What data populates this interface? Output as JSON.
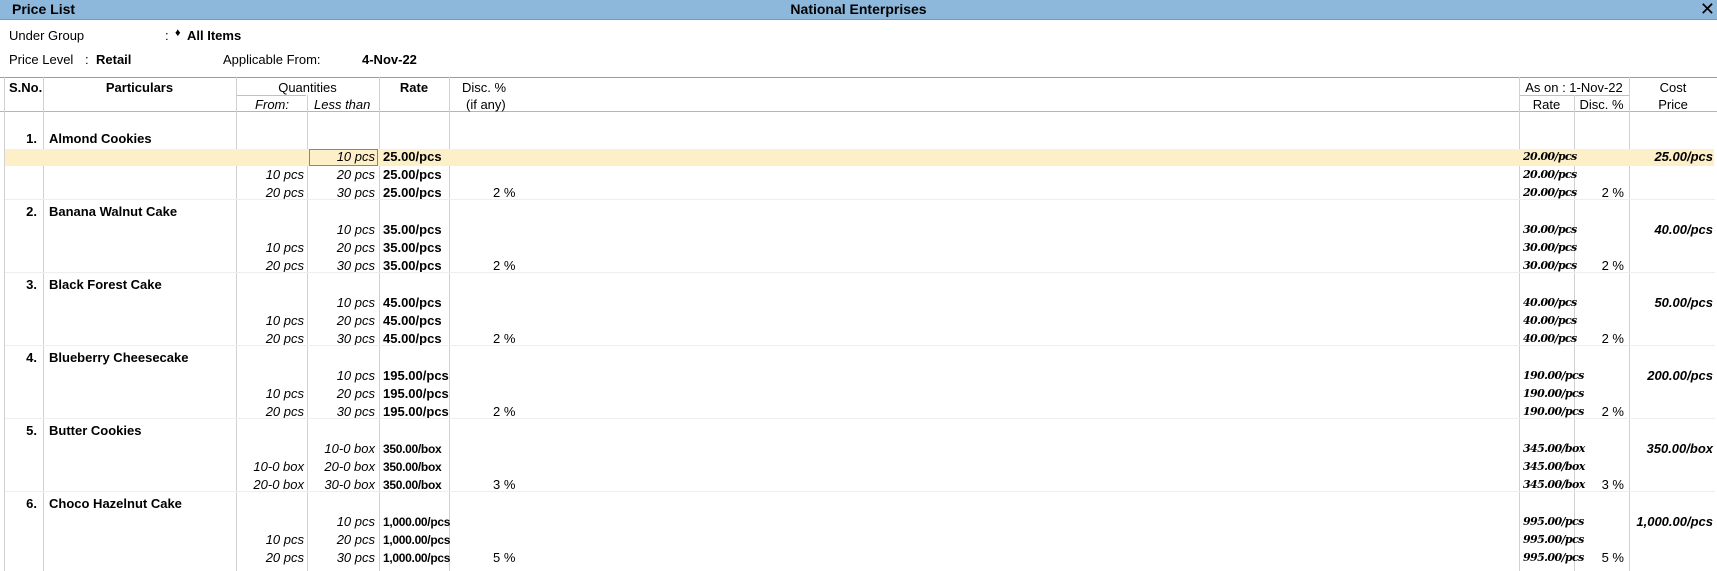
{
  "window": {
    "title": "Price List",
    "company": "National Enterprises",
    "close_glyph": "✕"
  },
  "filters": {
    "under_group_label": "Under Group",
    "under_group_colon": ":",
    "under_group_marker": "♦",
    "under_group_value": "All Items",
    "price_level_label": "Price Level",
    "price_level_colon": ":",
    "price_level_value": "Retail",
    "applicable_from_label": "Applicable From:",
    "applicable_from_value": "4-Nov-22"
  },
  "columns": {
    "sno": "S.No.",
    "particulars": "Particulars",
    "quantities": "Quantities",
    "from": "From:",
    "less_than": "Less than",
    "rate": "Rate",
    "disc": "Disc. %",
    "if_any": "(if any)",
    "as_on": "As on : 1-Nov-22",
    "as_on_rate": "Rate",
    "as_on_disc": "Disc. %",
    "cost": "Cost",
    "cost_price": "Price"
  },
  "items": [
    {
      "sno": "1.",
      "name": "Almond Cookies",
      "cost_price": "25.00/pcs",
      "slabs": [
        {
          "from": "",
          "less_than": "10 pcs",
          "rate": "25.00/pcs",
          "disc": "",
          "prev_rate": "20.00/pcs",
          "prev_disc": ""
        },
        {
          "from": "10 pcs",
          "less_than": "20 pcs",
          "rate": "25.00/pcs",
          "disc": "",
          "prev_rate": "20.00/pcs",
          "prev_disc": ""
        },
        {
          "from": "20 pcs",
          "less_than": "30 pcs",
          "rate": "25.00/pcs",
          "disc": "2 %",
          "prev_rate": "20.00/pcs",
          "prev_disc": "2 %"
        }
      ]
    },
    {
      "sno": "2.",
      "name": "Banana Walnut Cake",
      "cost_price": "40.00/pcs",
      "slabs": [
        {
          "from": "",
          "less_than": "10 pcs",
          "rate": "35.00/pcs",
          "disc": "",
          "prev_rate": "30.00/pcs",
          "prev_disc": ""
        },
        {
          "from": "10 pcs",
          "less_than": "20 pcs",
          "rate": "35.00/pcs",
          "disc": "",
          "prev_rate": "30.00/pcs",
          "prev_disc": ""
        },
        {
          "from": "20 pcs",
          "less_than": "30 pcs",
          "rate": "35.00/pcs",
          "disc": "2 %",
          "prev_rate": "30.00/pcs",
          "prev_disc": "2 %"
        }
      ]
    },
    {
      "sno": "3.",
      "name": "Black Forest Cake",
      "cost_price": "50.00/pcs",
      "slabs": [
        {
          "from": "",
          "less_than": "10 pcs",
          "rate": "45.00/pcs",
          "disc": "",
          "prev_rate": "40.00/pcs",
          "prev_disc": ""
        },
        {
          "from": "10 pcs",
          "less_than": "20 pcs",
          "rate": "45.00/pcs",
          "disc": "",
          "prev_rate": "40.00/pcs",
          "prev_disc": ""
        },
        {
          "from": "20 pcs",
          "less_than": "30 pcs",
          "rate": "45.00/pcs",
          "disc": "2 %",
          "prev_rate": "40.00/pcs",
          "prev_disc": "2 %"
        }
      ]
    },
    {
      "sno": "4.",
      "name": "Blueberry Cheesecake",
      "cost_price": "200.00/pcs",
      "slabs": [
        {
          "from": "",
          "less_than": "10 pcs",
          "rate": "195.00/pcs",
          "disc": "",
          "prev_rate": "190.00/pcs",
          "prev_disc": ""
        },
        {
          "from": "10 pcs",
          "less_than": "20 pcs",
          "rate": "195.00/pcs",
          "disc": "",
          "prev_rate": "190.00/pcs",
          "prev_disc": ""
        },
        {
          "from": "20 pcs",
          "less_than": "30 pcs",
          "rate": "195.00/pcs",
          "disc": "2 %",
          "prev_rate": "190.00/pcs",
          "prev_disc": "2 %"
        }
      ]
    },
    {
      "sno": "5.",
      "name": "Butter Cookies",
      "cost_price": "350.00/box",
      "slabs": [
        {
          "from": "",
          "less_than": "10-0 box",
          "rate": "350.00/box",
          "disc": "",
          "prev_rate": "345.00/box",
          "prev_disc": ""
        },
        {
          "from": "10-0 box",
          "less_than": "20-0 box",
          "rate": "350.00/box",
          "disc": "",
          "prev_rate": "345.00/box",
          "prev_disc": ""
        },
        {
          "from": "20-0 box",
          "less_than": "30-0 box",
          "rate": "350.00/box",
          "disc": "3 %",
          "prev_rate": "345.00/box",
          "prev_disc": "3 %"
        }
      ]
    },
    {
      "sno": "6.",
      "name": "Choco Hazelnut Cake",
      "cost_price": "1,000.00/pcs",
      "slabs": [
        {
          "from": "",
          "less_than": "10 pcs",
          "rate": "1,000.00/pcs",
          "disc": "",
          "prev_rate": "995.00/pcs",
          "prev_disc": ""
        },
        {
          "from": "10 pcs",
          "less_than": "20 pcs",
          "rate": "1,000.00/pcs",
          "disc": "",
          "prev_rate": "995.00/pcs",
          "prev_disc": ""
        },
        {
          "from": "20 pcs",
          "less_than": "30 pcs",
          "rate": "1,000.00/pcs",
          "disc": "5 %",
          "prev_rate": "995.00/pcs",
          "prev_disc": "5 %"
        }
      ]
    }
  ]
}
